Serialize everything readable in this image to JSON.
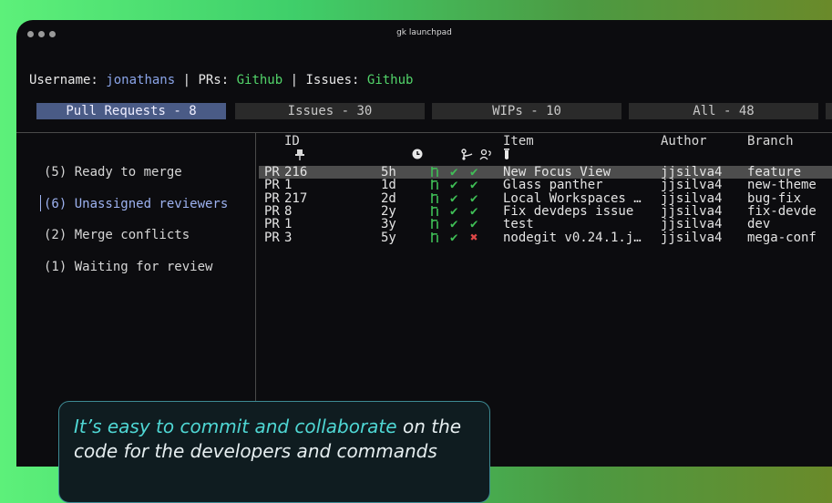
{
  "window": {
    "title": "gk launchpad"
  },
  "header": {
    "username_label": "Username: ",
    "username": "jonathans",
    "sep1": " | PRs: ",
    "prs_source": "Github",
    "sep2": " | Issues: ",
    "issues_source": "Github"
  },
  "tabs": [
    {
      "label": "Pull Requests - 8",
      "active": true
    },
    {
      "label": "Issues - 30"
    },
    {
      "label": "WIPs - 10"
    },
    {
      "label": "All - 48"
    }
  ],
  "sidebar": {
    "items": [
      {
        "label": "(5) Ready to merge"
      },
      {
        "label": "(6) Unassigned reviewers",
        "active": true
      },
      {
        "label": "(2) Merge conflicts"
      },
      {
        "label": "(1) Waiting for review"
      }
    ]
  },
  "table": {
    "headers": {
      "pin_icon": "pin-icon",
      "id": "ID",
      "time_icon": "clock-icon",
      "branch_icon": "git-branch-icon",
      "reviewer_icon": "reviewer-icon",
      "checks_icon": "flask-icon",
      "item": "Item",
      "author": "Author",
      "branch": "Branch"
    },
    "rows": [
      {
        "type": "PR",
        "id": "216",
        "age": "5h",
        "merge": "ok",
        "review": "ok",
        "checks": "ok",
        "item": "New Focus View",
        "author": "jjsilva4",
        "branch": "feature",
        "highlighted": true
      },
      {
        "type": "PR",
        "id": "1",
        "age": "1d",
        "merge": "ok",
        "review": "ok",
        "checks": "ok",
        "item": "Glass panther",
        "author": "jjsilva4",
        "branch": "new-theme"
      },
      {
        "type": "PR",
        "id": "217",
        "age": "2d",
        "merge": "ok",
        "review": "ok",
        "checks": "ok",
        "item": "Local Workspaces …",
        "author": "jjsilva4",
        "branch": "bug-fix"
      },
      {
        "type": "PR",
        "id": "8",
        "age": "2y",
        "merge": "ok",
        "review": "ok",
        "checks": "ok",
        "item": "Fix devdeps issue",
        "author": "jjsilva4",
        "branch": "fix-devde"
      },
      {
        "type": "PR",
        "id": "1",
        "age": "3y",
        "merge": "ok",
        "review": "ok",
        "checks": "ok",
        "item": "test",
        "author": "jjsilva4",
        "branch": "dev"
      },
      {
        "type": "PR",
        "id": "3",
        "age": "5y",
        "merge": "ok",
        "review": "ok",
        "checks": "fail",
        "item": "nodegit v0.24.1.j…",
        "author": "jjsilva4",
        "branch": "mega-conf"
      }
    ]
  },
  "callout": {
    "accent": "It’s easy to commit and collaborate",
    "rest": " on the code for the developers and commands"
  },
  "colors": {
    "accent_green": "#52d46a",
    "active_tab": "#4a5b86",
    "check_ok": "#3fbf56",
    "check_fail": "#e04848"
  }
}
